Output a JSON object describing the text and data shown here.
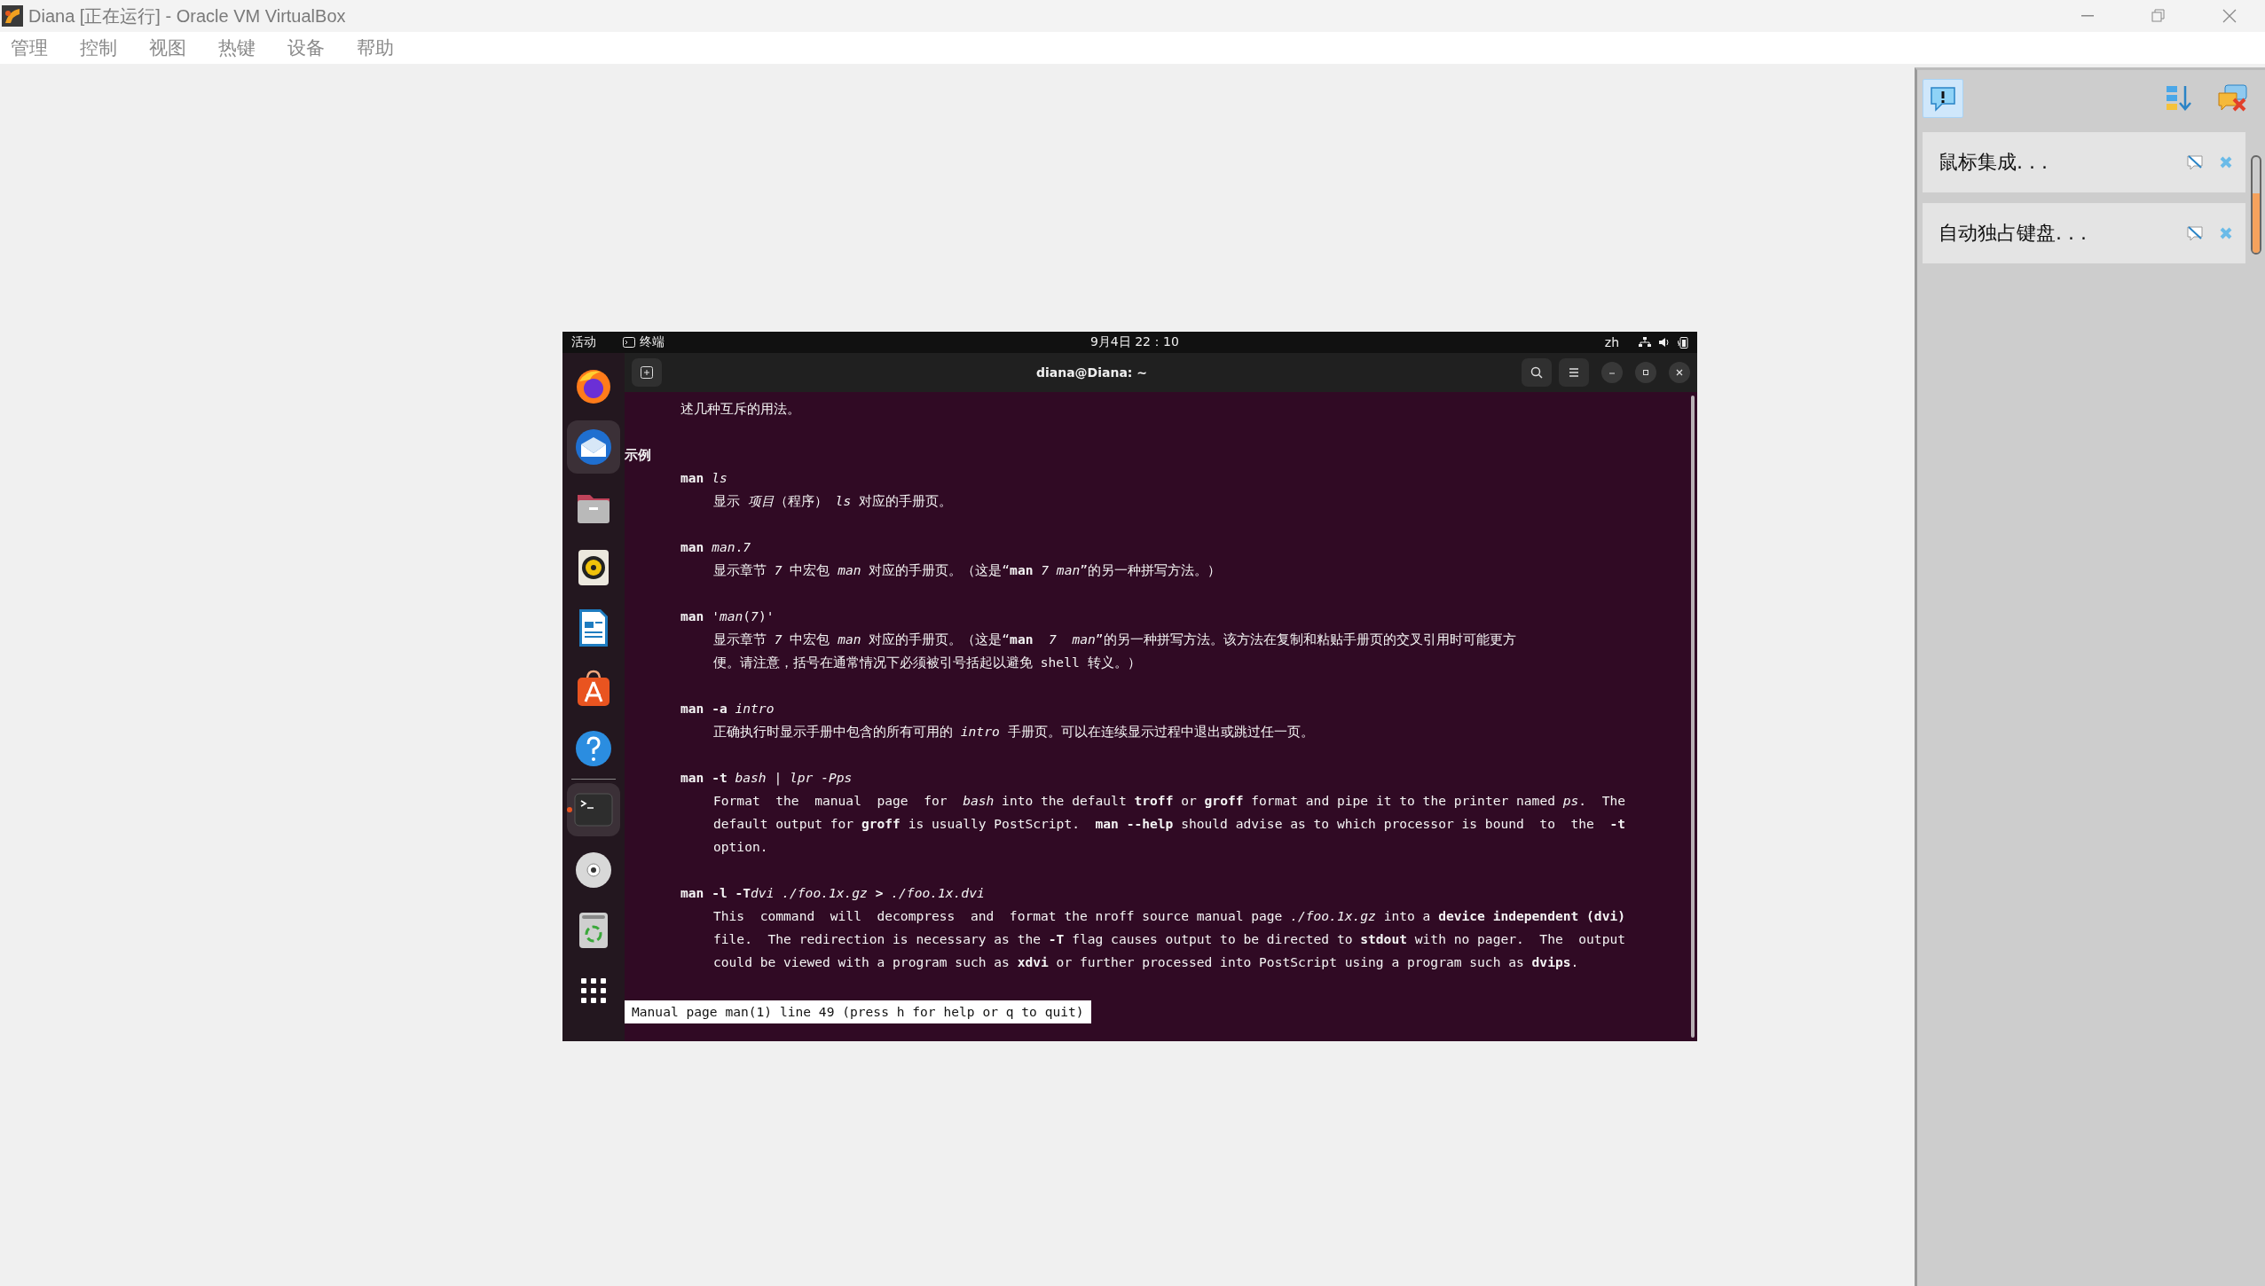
{
  "window": {
    "title": "Diana [正在运行] - Oracle VM VirtualBox"
  },
  "menu": [
    "管理",
    "控制",
    "视图",
    "热键",
    "设备",
    "帮助"
  ],
  "guest": {
    "top_bar": {
      "activities": "活动",
      "app": "终端",
      "clock": "9月4日 22：10",
      "input": "zh"
    },
    "dock": [
      {
        "kind": "firefox",
        "highlighted": false,
        "running": false
      },
      {
        "kind": "mail",
        "highlighted": true,
        "running": false
      },
      {
        "kind": "files",
        "highlighted": false,
        "running": false
      },
      {
        "kind": "music",
        "highlighted": false,
        "running": false
      },
      {
        "kind": "writer",
        "highlighted": false,
        "running": false
      },
      {
        "kind": "store",
        "highlighted": false,
        "running": false
      },
      {
        "kind": "help",
        "highlighted": false,
        "running": false
      },
      {
        "kind": "terminal",
        "highlighted": true,
        "running": true
      },
      {
        "kind": "disc",
        "highlighted": false,
        "running": false
      },
      {
        "kind": "trash",
        "highlighted": false,
        "running": false
      },
      {
        "kind": "apps",
        "highlighted": false,
        "running": false
      }
    ],
    "terminal": {
      "title": "diana@Diana: ~",
      "blocks": [
        [
          {
            "kind": "text",
            "text": "述几种互斥的用法。"
          }
        ],
        [
          {
            "kind": "heading",
            "text": "示例"
          },
          {
            "kind": "command",
            "text": "**man** *ls*"
          },
          {
            "kind": "description",
            "text": "显示 *项目*（程序） *ls* 对应的手册页。"
          }
        ],
        [
          {
            "kind": "command",
            "text": "**man** *man*.*7*"
          },
          {
            "kind": "description",
            "text": "显示章节 *7* 中宏包 *man* 对应的手册页。（这是“**man** *7* *man*”的另一种拼写方法。）"
          }
        ],
        [
          {
            "kind": "command",
            "text": "**man** '*man*(*7*)'"
          },
          {
            "kind": "description",
            "text": "显示章节 *7* 中宏包 *man* 对应的手册页。（这是“**man**  *7*  *man*”的另一种拼写方法。该方法在复制和粘贴手册页的交叉引用时可能更方"
          },
          {
            "kind": "description",
            "text": "便。请注意，括号在通常情况下必须被引号括起以避免 shell 转义。）"
          }
        ],
        [
          {
            "kind": "command",
            "text": "**man -a** *intro*"
          },
          {
            "kind": "description",
            "text": "正确执行时显示手册中包含的所有可用的 *intro* 手册页。可以在连续显示过程中退出或跳过任一页。"
          }
        ],
        [
          {
            "kind": "command",
            "text": "**man -t** *bash* | *lpr* *-Pps*"
          },
          {
            "kind": "description",
            "text": "Format  the  manual  page  for  *bash* into the default **troff** or **groff** format and pipe it to the printer named *ps*.  The"
          },
          {
            "kind": "description",
            "text": "default output for **groff** is usually PostScript.  **man --help** should advise as to which processor is bound  to  the  **-t**"
          },
          {
            "kind": "description",
            "text": "option."
          }
        ],
        [
          {
            "kind": "command",
            "parts": [
              "**man -l -T**",
              "*dvi* *./foo.1x.gz* **>** *./foo.1x.dvi*"
            ]
          },
          {
            "kind": "description",
            "text": "This  command  will  decompress  and  format the nroff source manual page *./foo.1x.gz* into a **device independent (dvi)**"
          },
          {
            "kind": "description",
            "text": "file.  The redirection is necessary as the **-T** flag causes output to be directed to **stdout** with no pager.  The  output"
          },
          {
            "kind": "description",
            "text": "could be viewed with a program such as **xdvi** or further processed into PostScript using a program such as **dvips**."
          }
        ]
      ],
      "status_line": "Manual page man(1) line 49 (press h for help or q to quit)"
    }
  },
  "notice_panel": {
    "toggle_checked": true,
    "notices": [
      {
        "text": "鼠标集成. . ."
      },
      {
        "text": "自动独占键盘. . ."
      }
    ]
  }
}
